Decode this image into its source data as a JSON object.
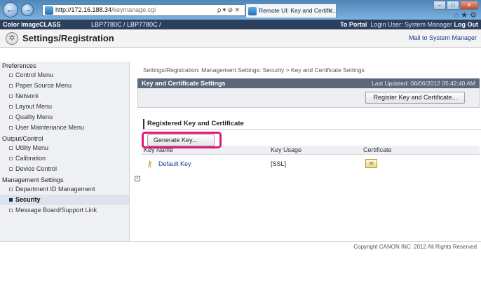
{
  "browser": {
    "url_host": "http://172.16.188.34",
    "url_path": "/keymanage.cgi",
    "address_icons": "ρ ▾ ⊘ ✕",
    "tab_title": "Remote UI: Key and Certific...",
    "tab_close": "✕",
    "back_glyph": "←",
    "forward_glyph": "→",
    "win_minimize": "–",
    "win_maximize": "□",
    "win_close": "✕",
    "tools_glyphs": "⌂ ★ ⚙"
  },
  "app": {
    "product": "Color imageCLASS",
    "model": "LBP7780C / LBP7780C /",
    "to_portal": "To Portal",
    "login_user": "Login User: System Manager",
    "log_out": "Log Out",
    "title": "Settings/Registration",
    "mail_link": "Mail to System Manager"
  },
  "sidebar": {
    "preferences": {
      "heading": "Preferences",
      "items": [
        {
          "label": "Control Menu"
        },
        {
          "label": "Paper Source Menu"
        },
        {
          "label": "Network"
        },
        {
          "label": "Layout Menu"
        },
        {
          "label": "Quality Menu"
        },
        {
          "label": "User Maintenance Menu"
        }
      ]
    },
    "output_control": {
      "heading": "Output/Control",
      "items": [
        {
          "label": "Utility Menu"
        },
        {
          "label": "Calibration"
        },
        {
          "label": "Device Control"
        }
      ]
    },
    "management": {
      "heading": "Management Settings",
      "items": [
        {
          "label": "Department ID Management"
        },
        {
          "label": "Security",
          "active": true
        },
        {
          "label": "Message Board/Support Link"
        }
      ]
    }
  },
  "main": {
    "breadcrumb": "Settings/Registration: Management Settings: Security > Key and Certificate Settings",
    "section_title": "Key and Certificate Settings",
    "last_updated": "Last Updated: 08/06/2012 05:42:40 AM",
    "register_button": "Register Key and Certificate...",
    "registered_title": "Registered Key and Certificate",
    "generate_button": "Generate Key...",
    "table": {
      "headers": [
        "Key Name",
        "Key Usage",
        "Certificate"
      ],
      "rows": [
        {
          "key_name": "Default Key",
          "key_usage": "[SSL]",
          "certificate_icon": "certificate-icon"
        }
      ]
    },
    "copyright": "Copyright CANON INC. 2012 All Rights Reserved"
  },
  "colors": {
    "app_bar": "#2b3f5e",
    "section_header": "#5a6879",
    "highlight_box": "#e2187a",
    "link": "#1a3d8a"
  }
}
